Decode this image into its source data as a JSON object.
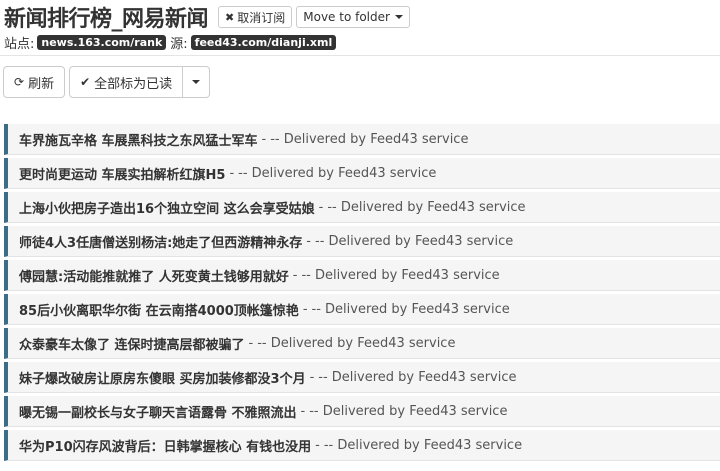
{
  "header": {
    "title": "新闻排行榜_网易新闻",
    "unsubscribe_label": "取消订阅",
    "move_folder_label": "Move to folder",
    "site_label": "站点:",
    "site_url": "news.163.com/rank",
    "source_label": "源:",
    "source_url": "feed43.com/dianji.xml"
  },
  "toolbar": {
    "refresh_label": "刷新",
    "mark_all_read_label": "全部标为已读"
  },
  "items": [
    {
      "title": "车界施瓦辛格 车展黑科技之东风猛士军车",
      "separator": "-",
      "description": "-- Delivered by Feed43 service"
    },
    {
      "title": "更时尚更运动 车展实拍解析红旗H5",
      "separator": "-",
      "description": "-- Delivered by Feed43 service"
    },
    {
      "title": "上海小伙把房子造出16个独立空间 这么会享受姑娘",
      "separator": "-",
      "description": "-- Delivered by Feed43 service"
    },
    {
      "title": "师徒4人3任唐僧送别杨洁:她走了但西游精神永存",
      "separator": "-",
      "description": "-- Delivered by Feed43 service"
    },
    {
      "title": "傅园慧:活动能推就推了 人死变黄土钱够用就好",
      "separator": "-",
      "description": "-- Delivered by Feed43 service"
    },
    {
      "title": "85后小伙离职华尔街 在云南搭4000顶帐篷惊艳",
      "separator": "-",
      "description": "-- Delivered by Feed43 service"
    },
    {
      "title": "众泰豪车太像了 连保时捷高层都被骗了",
      "separator": "-",
      "description": "-- Delivered by Feed43 service"
    },
    {
      "title": "妹子爆改破房让原房东傻眼 买房加装修都没3个月",
      "separator": "-",
      "description": "-- Delivered by Feed43 service"
    },
    {
      "title": "曝无锡一副校长与女子聊天言语露骨 不雅照流出",
      "separator": "-",
      "description": "-- Delivered by Feed43 service"
    },
    {
      "title": "华为P10闪存风波背后：日韩掌握核心 有钱也没用",
      "separator": "-",
      "description": "-- Delivered by Feed43 service"
    }
  ]
}
